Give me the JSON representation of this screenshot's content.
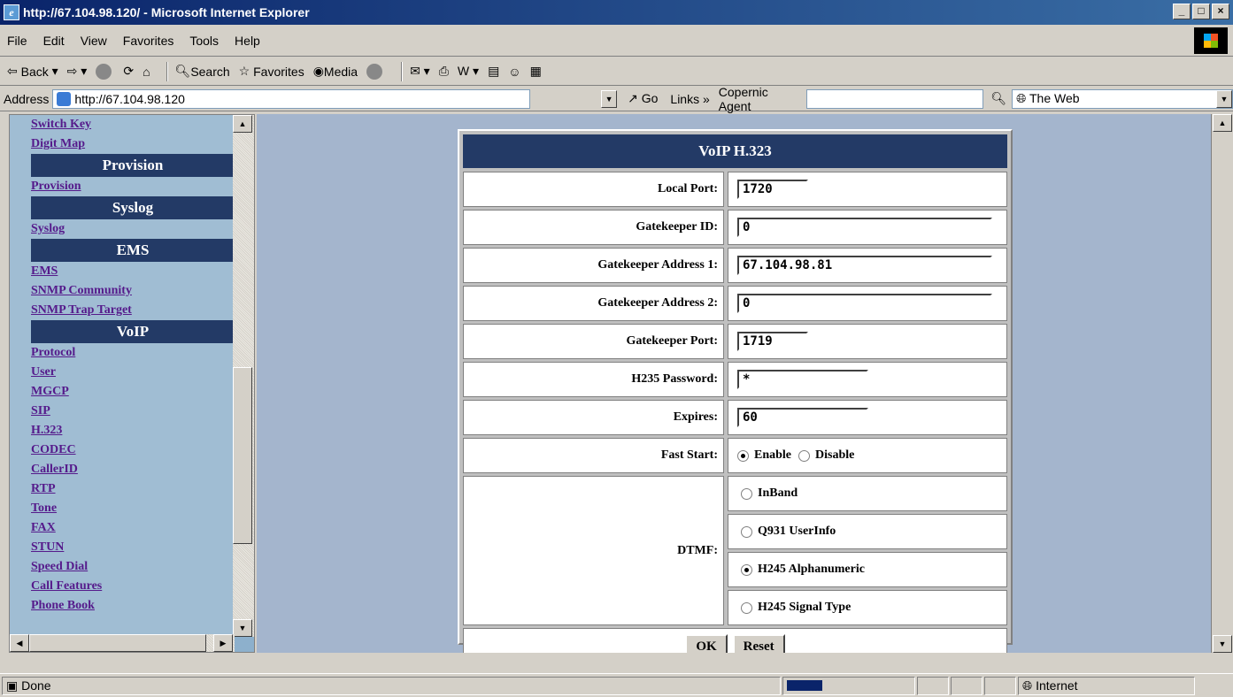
{
  "window": {
    "title": "http://67.104.98.120/ - Microsoft Internet Explorer"
  },
  "menu": [
    "File",
    "Edit",
    "View",
    "Favorites",
    "Tools",
    "Help"
  ],
  "toolbar": {
    "back": "Back",
    "search": "Search",
    "favorites": "Favorites",
    "media": "Media"
  },
  "address": {
    "label": "Address",
    "url": "http://67.104.98.120",
    "go": "Go",
    "links": "Links",
    "copernic": "Copernic Agent",
    "web_select": "The Web"
  },
  "sidebar": {
    "top_links": [
      "Switch Key",
      "Digit Map"
    ],
    "provision_head": "Provision",
    "provision_links": [
      "Provision"
    ],
    "syslog_head": "Syslog",
    "syslog_links": [
      "Syslog"
    ],
    "ems_head": "EMS",
    "ems_links": [
      "EMS",
      "SNMP Community",
      "SNMP Trap Target"
    ],
    "voip_head": "VoIP",
    "voip_links": [
      "Protocol",
      "User",
      "MGCP",
      "SIP",
      "H.323",
      "CODEC",
      "CallerID",
      "RTP",
      "Tone",
      "FAX",
      "STUN",
      "Speed Dial",
      "Call Features",
      "Phone Book"
    ]
  },
  "form": {
    "title": "VoIP H.323",
    "local_port": {
      "label": "Local Port:",
      "value": "1720"
    },
    "gatekeeper_id": {
      "label": "Gatekeeper ID:",
      "value": "0"
    },
    "gatekeeper_addr1": {
      "label": "Gatekeeper Address 1:",
      "value": "67.104.98.81"
    },
    "gatekeeper_addr2": {
      "label": "Gatekeeper Address 2:",
      "value": "0"
    },
    "gatekeeper_port": {
      "label": "Gatekeeper Port:",
      "value": "1719"
    },
    "h235_password": {
      "label": "H235 Password:",
      "value": "*"
    },
    "expires": {
      "label": "Expires:",
      "value": "60"
    },
    "fast_start": {
      "label": "Fast Start:",
      "enable": "Enable",
      "disable": "Disable",
      "selected": "Enable"
    },
    "dtmf": {
      "label": "DTMF:",
      "options": [
        "InBand",
        "Q931 UserInfo",
        "H245 Alphanumeric",
        "H245 Signal Type"
      ],
      "selected": "H245 Alphanumeric"
    },
    "ok": "OK",
    "reset": "Reset"
  },
  "status": {
    "text": "Done",
    "zone": "Internet"
  }
}
